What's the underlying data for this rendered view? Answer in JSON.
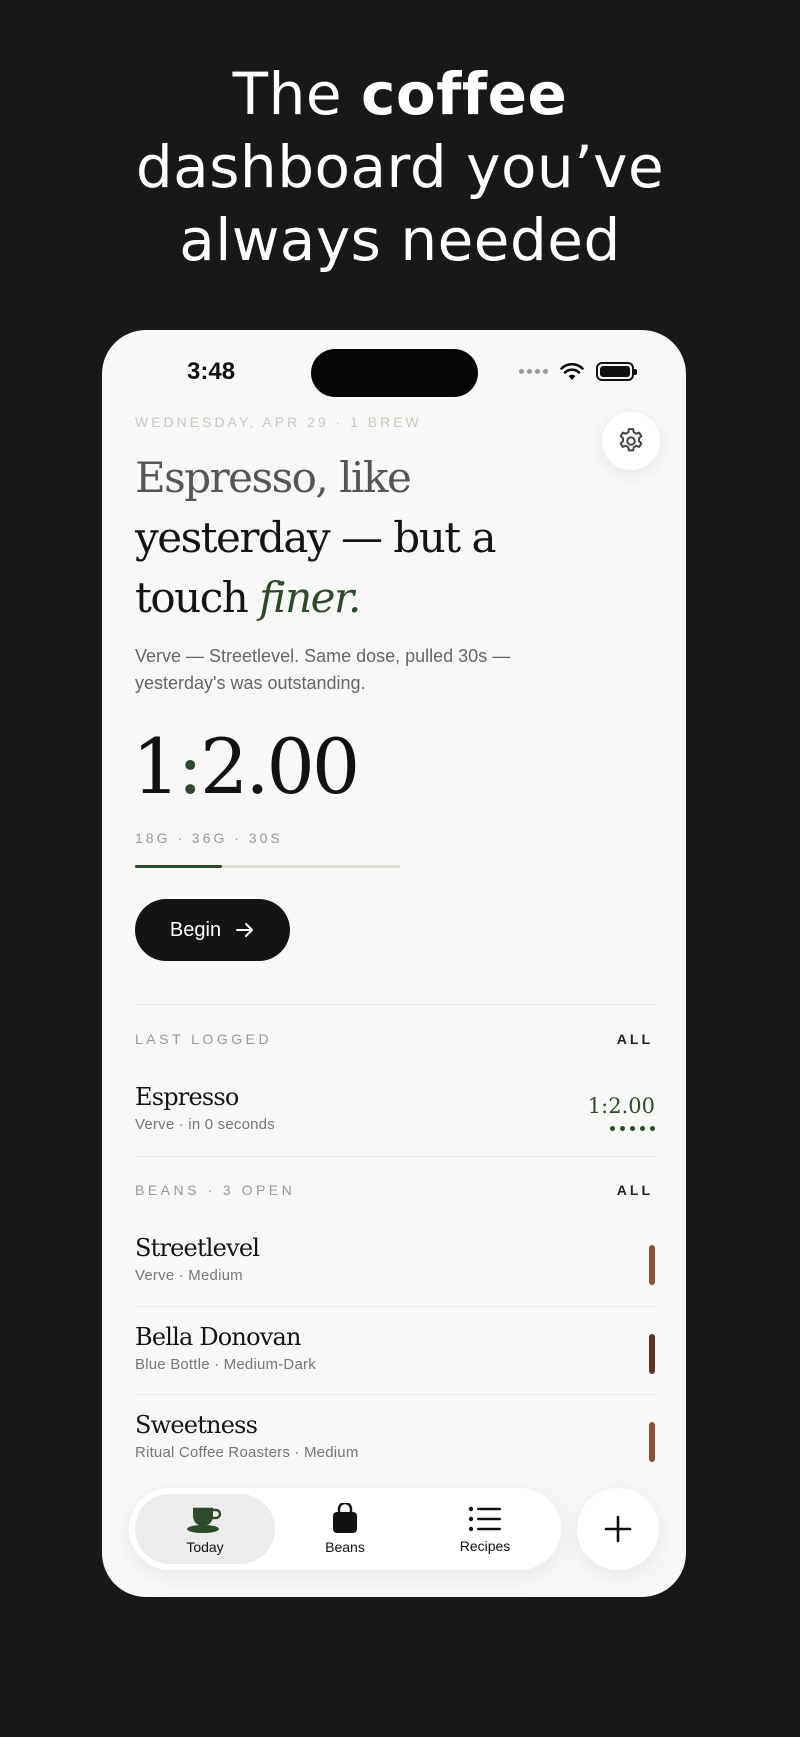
{
  "headline": {
    "pre": "The ",
    "bold": "coffee",
    "line2": "dashboard you’ve",
    "line3": "always needed"
  },
  "status_bar": {
    "time": "3:48"
  },
  "today": {
    "date_line": "WEDNESDAY, APR 29 · 1 BREW",
    "title_line1": "Espresso, like",
    "title_line2": "yesterday — but a",
    "title_line3_pre": "touch ",
    "title_accent": "finer.",
    "subtitle": "Verve — Streetlevel. Same dose, pulled 30s — yesterday's was outstanding.",
    "ratio_left": "1",
    "ratio_colon": ":",
    "ratio_right": "2.00",
    "ratio_meta": "18G · 36G · 30S",
    "progress_fraction": 0.33,
    "begin_label": "Begin"
  },
  "last_logged": {
    "label": "LAST LOGGED",
    "all_label": "ALL",
    "item": {
      "title": "Espresso",
      "subtitle": "Verve · in 0 seconds",
      "ratio": "1:2.00",
      "rating": 5
    }
  },
  "beans": {
    "label": "BEANS · 3 OPEN",
    "all_label": "ALL",
    "items": [
      {
        "title": "Streetlevel",
        "subtitle": "Verve · Medium",
        "roast_color": "#8a5230"
      },
      {
        "title": "Bella Donovan",
        "subtitle": "Blue Bottle · Medium-Dark",
        "roast_color": "#5e3522"
      },
      {
        "title": "Sweetness",
        "subtitle": "Ritual Coffee Roasters · Medium",
        "roast_color": "#8a5230"
      }
    ]
  },
  "tabbar": {
    "tabs": [
      {
        "label": "Today",
        "icon": "coffee-cup-icon",
        "active": true
      },
      {
        "label": "Beans",
        "icon": "bag-icon",
        "active": false
      },
      {
        "label": "Recipes",
        "icon": "list-icon",
        "active": false
      }
    ],
    "fab_icon": "plus-icon"
  },
  "colors": {
    "accent": "#2d4a2a",
    "background": "#181818",
    "surface": "#f8f8f6",
    "button": "#141414"
  }
}
